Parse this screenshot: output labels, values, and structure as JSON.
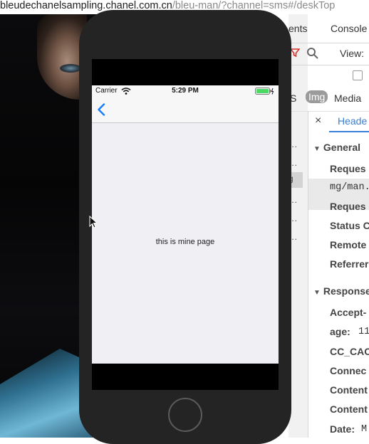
{
  "browser": {
    "url_host": "bleudechanelsampling.chanel.com.cn",
    "url_path": "/bleu-man/?channel=sms#/deskTop"
  },
  "devtools": {
    "tabs": [
      "ents",
      "Console"
    ],
    "view_label": "View:",
    "type_filters": [
      "S",
      "Img",
      "Media"
    ],
    "close_label": "×",
    "headers_tab": "Heade",
    "list_rows": [
      "...",
      "...",
      "g",
      "...",
      "...",
      "..."
    ],
    "general": {
      "title": "General",
      "rows": [
        {
          "key": "Reques",
          "value": "mg/man."
        },
        {
          "key": "Reques"
        },
        {
          "key": "Status C"
        },
        {
          "key": "Remote"
        },
        {
          "key": "Referrer"
        }
      ]
    },
    "response": {
      "title": "Response",
      "rows": [
        {
          "key": "Accept-"
        },
        {
          "key": "age:",
          "value": "11"
        },
        {
          "key": "CC_CAC"
        },
        {
          "key": "Connec"
        },
        {
          "key": "Content"
        },
        {
          "key": "Content"
        },
        {
          "key": "Date:",
          "value": "M"
        }
      ]
    }
  },
  "phone": {
    "status_bar": {
      "carrier": "Carrier",
      "time": "5:29 PM"
    },
    "content_text": "this is mine page"
  },
  "icons": [
    "back-chevron-icon",
    "wifi-icon",
    "battery-icon",
    "filter-icon",
    "search-icon",
    "cursor-icon"
  ],
  "colors": {
    "ios_blue": "#157efb",
    "devtools_blue": "#3b80d6",
    "filter_red": "#d9302a"
  }
}
